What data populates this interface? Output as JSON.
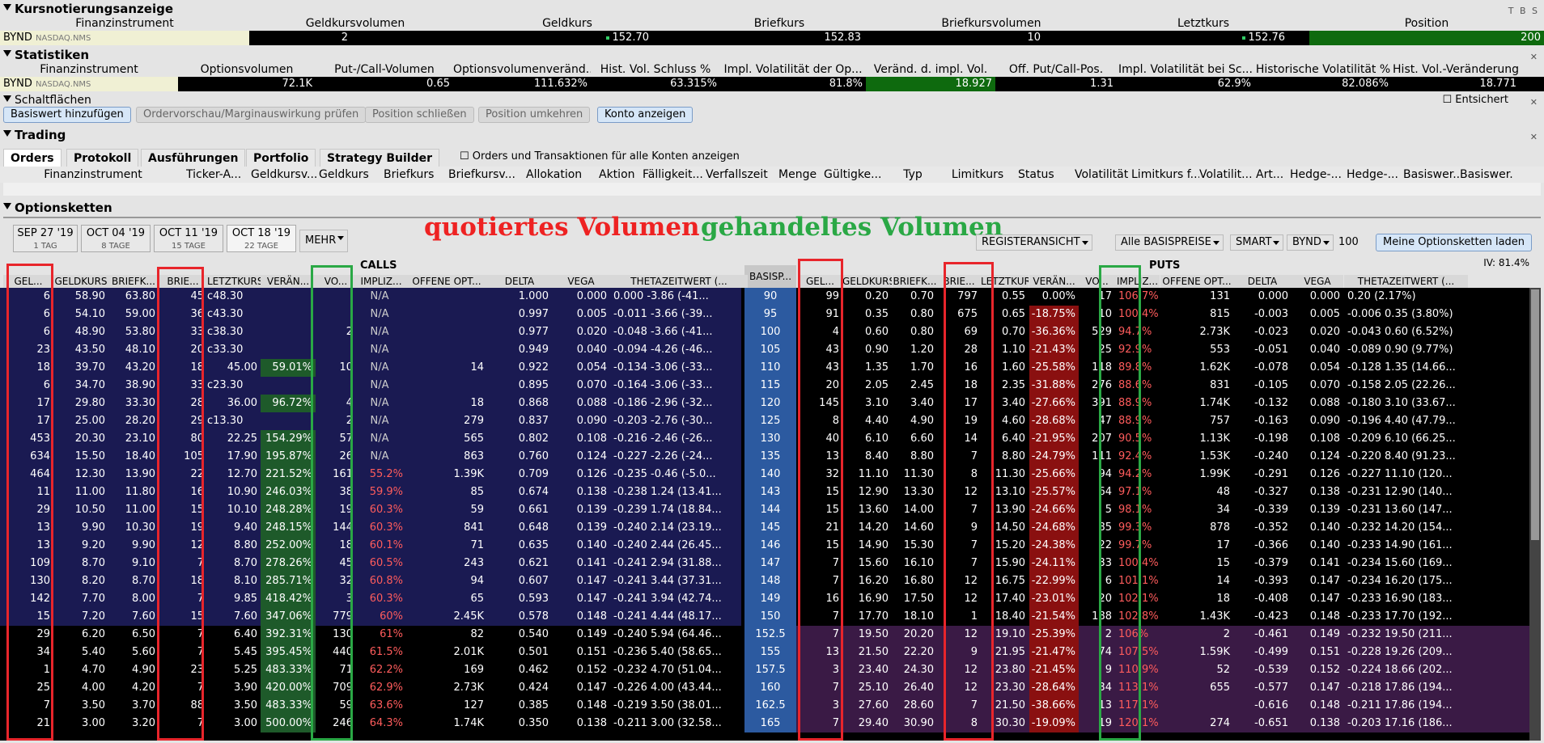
{
  "quote": {
    "title": "Kursnotierungsanzeige",
    "ctrls": "T B S",
    "headers": [
      "Finanzinstrument",
      "Geldkursvolumen",
      "Geldkurs",
      "Briefkurs",
      "Briefkursvolumen",
      "Letztkurs",
      "Position"
    ],
    "symbol": "BYND",
    "exchange": "NASDAQ.NMS",
    "bid_size": "2",
    "bid": "152.70",
    "ask": "152.83",
    "ask_size": "10",
    "last": "152.76",
    "position": "200"
  },
  "stats": {
    "title": "Statistiken",
    "headers": [
      "Finanzinstrument",
      "Optionsvolumen",
      "Put-/Call-Volumen",
      "Optionsvolumenveränd...",
      "Hist. Vol. Schluss %",
      "Impl. Volatilität der Op...",
      "Veränd. d. impl. Vol.",
      "Off. Put/Call-Pos.",
      "Impl. Volatilität bei Sc...",
      "Historische Volatilität %",
      "Hist. Vol.-Veränderung"
    ],
    "values": [
      "72.1K",
      "0.65",
      "111.632%",
      "63.315%",
      "81.8%",
      "18.927",
      "1.31",
      "62.9%",
      "82.086%",
      "18.771"
    ]
  },
  "buttons": {
    "title": "Schaltflächen",
    "entsichert": "Entsichert",
    "items": [
      "Basiswert hinzufügen",
      "Ordervorschau/Marginauswirkung prüfen",
      "Position schließen",
      "Position umkehren",
      "Konto anzeigen"
    ]
  },
  "trading": {
    "title": "Trading",
    "tabs": [
      "Orders",
      "Protokoll",
      "Ausführungen",
      "Portfolio",
      "Strategy Builder"
    ],
    "checkbox_label": "Orders und Transaktionen für alle Konten anzeigen",
    "headers": [
      "Finanzinstrument",
      "Ticker-A...",
      "Geldkursv...",
      "Geldkurs",
      "Briefkurs",
      "Briefkursv...",
      "Allokation",
      "Aktion",
      "Fälligkeit...",
      "Verfallszeit",
      "Menge",
      "Gültigke...",
      "Typ",
      "Limitkurs",
      "Status",
      "Volatilität",
      "Limitkurs f...",
      "Volatilit...",
      "Art...",
      "Hedge-...",
      "Hedge-...",
      "Basiswer...",
      "Basiswer..."
    ]
  },
  "chains": {
    "title": "Optionsketten",
    "expiries": [
      {
        "date": "SEP 27 '19",
        "days": "1 TAG"
      },
      {
        "date": "OCT 04 '19",
        "days": "8 TAGE"
      },
      {
        "date": "OCT 11 '19",
        "days": "15 TAGE"
      },
      {
        "date": "OCT 18 '19",
        "days": "22 TAGE"
      }
    ],
    "more": "MEHR",
    "annotation_red": "quotiertes Volumen",
    "annotation_green": "gehandeltes Volumen",
    "view": "REGISTERANSICHT",
    "strikes_filter": "Alle BASISPREISE",
    "exchange": "SMART",
    "underlying": "BYND",
    "qty": "100",
    "load_button": "Meine Optionsketten laden",
    "iv": "IV: 81.4%",
    "calls_label": "CALLS",
    "puts_label": "PUTS",
    "strike_header": "BASISP...",
    "call_headers": [
      "GEL...",
      "GELDKURS",
      "BRIEFK...",
      "BRIE...",
      "LETZTKURS",
      "VERÄN...",
      "VO...",
      "IMPLIZ...",
      "OFFENE OPT...",
      "DELTA",
      "VEGA",
      "THETAZEITWERT (..."
    ],
    "put_headers": [
      "GEL...",
      "GELDKURS",
      "BRIEFK...",
      "BRIE...",
      "LETZTKURS",
      "VERÄN...",
      "VO...",
      "IMPLIZ...",
      "OFFENE OPT...",
      "DELTA",
      "VEGA",
      "THETAZEITWERT (..."
    ],
    "rows": [
      {
        "k": "90",
        "c": [
          "6",
          "58.90",
          "63.80",
          "45",
          "c48.30",
          "",
          "",
          "N/A",
          "",
          "1.000",
          "0.000",
          "0.000 -3.86 (-41..."
        ],
        "p": [
          "99",
          "0.20",
          "0.70",
          "797",
          "0.55",
          "0.00%",
          "17",
          "106.7%",
          "131",
          "0.000",
          "0.000",
          "0.20 (2.17%)"
        ]
      },
      {
        "k": "95",
        "c": [
          "6",
          "54.10",
          "59.00",
          "36",
          "c43.30",
          "",
          "",
          "N/A",
          "",
          "0.997",
          "0.005",
          "-0.011 -3.66 (-39..."
        ],
        "p": [
          "91",
          "0.35",
          "0.80",
          "675",
          "0.65",
          "-18.75%",
          "10",
          "100.4%",
          "815",
          "-0.003",
          "0.005",
          "-0.006 0.35 (3.80%)"
        ]
      },
      {
        "k": "100",
        "c": [
          "6",
          "48.90",
          "53.80",
          "33",
          "c38.30",
          "",
          "2",
          "N/A",
          "",
          "0.977",
          "0.020",
          "-0.048 -3.66 (-41..."
        ],
        "p": [
          "4",
          "0.60",
          "0.80",
          "69",
          "0.70",
          "-36.36%",
          "529",
          "94.7%",
          "2.73K",
          "-0.023",
          "0.020",
          "-0.043 0.60 (6.52%)"
        ]
      },
      {
        "k": "105",
        "c": [
          "23",
          "43.50",
          "48.10",
          "20",
          "c33.30",
          "",
          "",
          "N/A",
          "",
          "0.949",
          "0.040",
          "-0.094 -4.26 (-46..."
        ],
        "p": [
          "43",
          "0.90",
          "1.20",
          "28",
          "1.10",
          "-21.43%",
          "25",
          "92.9%",
          "553",
          "-0.051",
          "0.040",
          "-0.089 0.90 (9.77%)"
        ]
      },
      {
        "k": "110",
        "c": [
          "18",
          "39.70",
          "43.20",
          "18",
          "45.00",
          "59.01%",
          "10",
          "N/A",
          "14",
          "0.922",
          "0.054",
          "-0.134 -3.06 (-33..."
        ],
        "p": [
          "43",
          "1.35",
          "1.70",
          "16",
          "1.60",
          "-25.58%",
          "118",
          "89.8%",
          "1.62K",
          "-0.078",
          "0.054",
          "-0.128 1.35 (14.66..."
        ]
      },
      {
        "k": "115",
        "c": [
          "6",
          "34.70",
          "38.90",
          "33",
          "c23.30",
          "",
          "",
          "N/A",
          "",
          "0.895",
          "0.070",
          "-0.164 -3.06 (-33..."
        ],
        "p": [
          "20",
          "2.05",
          "2.45",
          "18",
          "2.35",
          "-31.88%",
          "276",
          "88.6%",
          "831",
          "-0.105",
          "0.070",
          "-0.158 2.05 (22.26..."
        ]
      },
      {
        "k": "120",
        "c": [
          "17",
          "29.80",
          "33.30",
          "28",
          "36.00",
          "96.72%",
          "4",
          "N/A",
          "18",
          "0.868",
          "0.088",
          "-0.186 -2.96 (-32..."
        ],
        "p": [
          "145",
          "3.10",
          "3.40",
          "17",
          "3.40",
          "-27.66%",
          "391",
          "88.9%",
          "1.74K",
          "-0.132",
          "0.088",
          "-0.180 3.10 (33.67..."
        ]
      },
      {
        "k": "125",
        "c": [
          "17",
          "25.00",
          "28.20",
          "29",
          "c13.30",
          "",
          "2",
          "N/A",
          "279",
          "0.837",
          "0.090",
          "-0.203 -2.76 (-30..."
        ],
        "p": [
          "8",
          "4.40",
          "4.90",
          "19",
          "4.60",
          "-28.68%",
          "47",
          "88.9%",
          "757",
          "-0.163",
          "0.090",
          "-0.196 4.40 (47.79..."
        ]
      },
      {
        "k": "130",
        "c": [
          "453",
          "20.30",
          "23.10",
          "80",
          "22.25",
          "154.29%",
          "57",
          "N/A",
          "565",
          "0.802",
          "0.108",
          "-0.216 -2.46 (-26..."
        ],
        "p": [
          "40",
          "6.10",
          "6.60",
          "14",
          "6.40",
          "-21.95%",
          "207",
          "90.5%",
          "1.13K",
          "-0.198",
          "0.108",
          "-0.209 6.10 (66.25..."
        ]
      },
      {
        "k": "135",
        "c": [
          "634",
          "15.50",
          "18.40",
          "105",
          "17.90",
          "195.87%",
          "26",
          "N/A",
          "863",
          "0.760",
          "0.124",
          "-0.227 -2.26 (-24..."
        ],
        "p": [
          "13",
          "8.40",
          "8.80",
          "7",
          "8.80",
          "-24.79%",
          "111",
          "92.4%",
          "1.53K",
          "-0.240",
          "0.124",
          "-0.220 8.40 (91.23..."
        ]
      },
      {
        "k": "140",
        "c": [
          "464",
          "12.30",
          "13.90",
          "22",
          "12.70",
          "221.52%",
          "161",
          "55.2%",
          "1.39K",
          "0.709",
          "0.126",
          "-0.235 -0.46 (-5.0..."
        ],
        "p": [
          "32",
          "11.10",
          "11.30",
          "8",
          "11.30",
          "-25.66%",
          "94",
          "94.2%",
          "1.99K",
          "-0.291",
          "0.126",
          "-0.227 11.10 (120..."
        ]
      },
      {
        "k": "143",
        "c": [
          "11",
          "11.00",
          "11.80",
          "16",
          "10.90",
          "246.03%",
          "38",
          "59.9%",
          "85",
          "0.674",
          "0.138",
          "-0.238 1.24 (13.41..."
        ],
        "p": [
          "15",
          "12.90",
          "13.30",
          "12",
          "13.10",
          "-25.57%",
          "64",
          "97.1%",
          "48",
          "-0.327",
          "0.138",
          "-0.231 12.90 (140..."
        ]
      },
      {
        "k": "144",
        "c": [
          "29",
          "10.50",
          "11.00",
          "15",
          "10.10",
          "248.28%",
          "19",
          "60.3%",
          "59",
          "0.661",
          "0.139",
          "-0.239 1.74 (18.84..."
        ],
        "p": [
          "15",
          "13.60",
          "14.00",
          "7",
          "13.90",
          "-24.66%",
          "5",
          "98.1%",
          "34",
          "-0.339",
          "0.139",
          "-0.231 13.60 (147..."
        ]
      },
      {
        "k": "145",
        "c": [
          "13",
          "9.90",
          "10.30",
          "19",
          "9.40",
          "248.15%",
          "144",
          "60.3%",
          "841",
          "0.648",
          "0.139",
          "-0.240 2.14 (23.19..."
        ],
        "p": [
          "21",
          "14.20",
          "14.60",
          "9",
          "14.50",
          "-24.68%",
          "85",
          "99.3%",
          "878",
          "-0.352",
          "0.140",
          "-0.232 14.20 (154..."
        ]
      },
      {
        "k": "146",
        "c": [
          "13",
          "9.20",
          "9.90",
          "12",
          "8.80",
          "252.00%",
          "18",
          "60.1%",
          "71",
          "0.635",
          "0.140",
          "-0.240 2.44 (26.45..."
        ],
        "p": [
          "15",
          "14.90",
          "15.30",
          "7",
          "15.20",
          "-24.38%",
          "22",
          "99.7%",
          "17",
          "-0.366",
          "0.140",
          "-0.233 14.90 (161..."
        ]
      },
      {
        "k": "147",
        "c": [
          "109",
          "8.70",
          "9.10",
          "7",
          "8.70",
          "278.26%",
          "45",
          "60.5%",
          "243",
          "0.621",
          "0.141",
          "-0.241 2.94 (31.88..."
        ],
        "p": [
          "7",
          "15.60",
          "16.10",
          "7",
          "15.90",
          "-24.11%",
          "33",
          "100.4%",
          "15",
          "-0.379",
          "0.141",
          "-0.234 15.60 (169..."
        ]
      },
      {
        "k": "148",
        "c": [
          "130",
          "8.20",
          "8.70",
          "18",
          "8.10",
          "285.71%",
          "32",
          "60.8%",
          "94",
          "0.607",
          "0.147",
          "-0.241 3.44 (37.31..."
        ],
        "p": [
          "7",
          "16.20",
          "16.80",
          "12",
          "16.75",
          "-22.99%",
          "6",
          "101.1%",
          "14",
          "-0.393",
          "0.147",
          "-0.234 16.20 (175..."
        ]
      },
      {
        "k": "149",
        "c": [
          "142",
          "7.70",
          "8.00",
          "7",
          "9.85",
          "418.42%",
          "3",
          "60.3%",
          "65",
          "0.593",
          "0.147",
          "-0.241 3.94 (42.74..."
        ],
        "p": [
          "16",
          "16.90",
          "17.50",
          "12",
          "17.40",
          "-23.01%",
          "20",
          "102.1%",
          "18",
          "-0.408",
          "0.147",
          "-0.233 16.90 (183..."
        ]
      },
      {
        "k": "150",
        "c": [
          "15",
          "7.20",
          "7.60",
          "15",
          "7.60",
          "347.06%",
          "779",
          "60%",
          "2.45K",
          "0.578",
          "0.148",
          "-0.241 4.44 (48.17..."
        ],
        "p": [
          "7",
          "17.70",
          "18.10",
          "1",
          "18.40",
          "-21.54%",
          "188",
          "102.8%",
          "1.43K",
          "-0.423",
          "0.148",
          "-0.233 17.70 (192..."
        ]
      },
      {
        "k": "152.5",
        "c": [
          "29",
          "6.20",
          "6.50",
          "7",
          "6.40",
          "392.31%",
          "130",
          "61%",
          "82",
          "0.540",
          "0.149",
          "-0.240 5.94 (64.46..."
        ],
        "p": [
          "7",
          "19.50",
          "20.20",
          "12",
          "19.10",
          "-25.39%",
          "2",
          "106%",
          "2",
          "-0.461",
          "0.149",
          "-0.232 19.50 (211..."
        ]
      },
      {
        "k": "155",
        "c": [
          "34",
          "5.40",
          "5.60",
          "7",
          "5.45",
          "395.45%",
          "440",
          "61.5%",
          "2.01K",
          "0.501",
          "0.151",
          "-0.236 5.40 (58.65..."
        ],
        "p": [
          "13",
          "21.50",
          "22.20",
          "9",
          "21.95",
          "-21.47%",
          "74",
          "107.5%",
          "1.59K",
          "-0.499",
          "0.151",
          "-0.228 19.26 (209..."
        ]
      },
      {
        "k": "157.5",
        "c": [
          "1",
          "4.70",
          "4.90",
          "23",
          "5.25",
          "483.33%",
          "71",
          "62.2%",
          "169",
          "0.462",
          "0.152",
          "-0.232 4.70 (51.04..."
        ],
        "p": [
          "3",
          "23.40",
          "24.30",
          "12",
          "23.80",
          "-21.45%",
          "9",
          "110.9%",
          "52",
          "-0.539",
          "0.152",
          "-0.224 18.66 (202..."
        ]
      },
      {
        "k": "160",
        "c": [
          "25",
          "4.00",
          "4.20",
          "7",
          "3.90",
          "420.00%",
          "709",
          "62.9%",
          "2.73K",
          "0.424",
          "0.147",
          "-0.226 4.00 (43.44..."
        ],
        "p": [
          "7",
          "25.10",
          "26.40",
          "12",
          "23.30",
          "-28.64%",
          "34",
          "113.1%",
          "655",
          "-0.577",
          "0.147",
          "-0.218 17.86 (194..."
        ]
      },
      {
        "k": "162.5",
        "c": [
          "7",
          "3.50",
          "3.70",
          "88",
          "3.50",
          "483.33%",
          "59",
          "63.6%",
          "127",
          "0.385",
          "0.148",
          "-0.219 3.50 (38.01..."
        ],
        "p": [
          "3",
          "27.60",
          "28.60",
          "7",
          "21.50",
          "-38.66%",
          "13",
          "117.1%",
          "",
          "-0.616",
          "0.148",
          "-0.211 17.86 (194..."
        ]
      },
      {
        "k": "165",
        "c": [
          "21",
          "3.00",
          "3.20",
          "7",
          "3.00",
          "500.00%",
          "246",
          "64.3%",
          "1.74K",
          "0.350",
          "0.138",
          "-0.211 3.00 (32.58..."
        ],
        "p": [
          "7",
          "29.40",
          "30.90",
          "8",
          "30.30",
          "-19.09%",
          "19",
          "120.1%",
          "274",
          "-0.651",
          "0.138",
          "-0.203 17.16 (186..."
        ]
      }
    ]
  },
  "colors": {
    "red_box": "#e8252b",
    "green_box": "#2aa845",
    "strike_bg": "#2c5aa0",
    "call_itm": "#1a1a52",
    "put_itm": "#3a1a45"
  }
}
